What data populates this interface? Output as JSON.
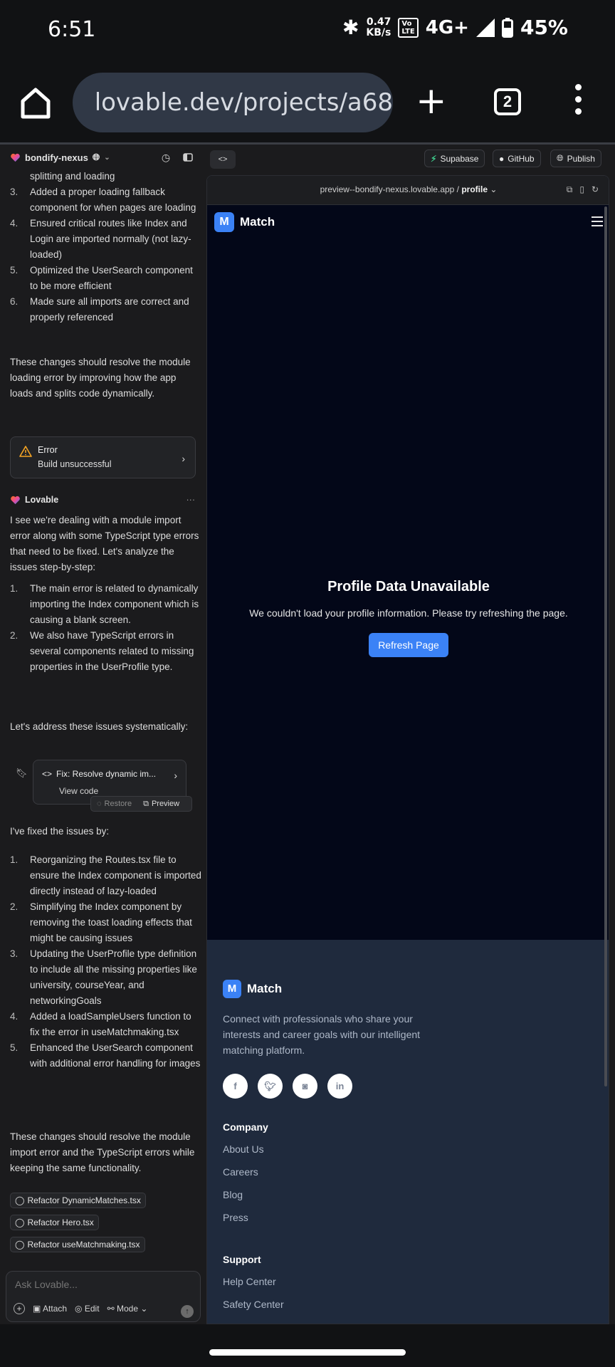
{
  "status_bar": {
    "time": "6:51",
    "net_speed_value": "0.47",
    "net_speed_unit": "KB/s",
    "volte_top": "Vo",
    "volte_bottom": "LTE",
    "network": "4G+",
    "battery": "45%"
  },
  "browser": {
    "url": "lovable.dev/projects/a68",
    "tab_count": "2"
  },
  "app_header": {
    "project_name": "bondify-nexus",
    "supabase_label": "Supabase",
    "github_label": "GitHub",
    "publish_label": "Publish",
    "code_toggle": "<>"
  },
  "chat": {
    "list1": [
      {
        "num": "",
        "text": "splitting and loading"
      },
      {
        "num": "3.",
        "text": "Added a proper loading fallback component for when pages are loading"
      },
      {
        "num": "4.",
        "text": "Ensured critical routes like Index and Login are imported normally (not lazy-loaded)"
      },
      {
        "num": "5.",
        "text": "Optimized the UserSearch component to be more efficient"
      },
      {
        "num": "6.",
        "text": "Made sure all imports are correct and properly referenced"
      }
    ],
    "para1": "These changes should resolve the module loading error by improving how the app loads and splits code dynamically.",
    "error_title": "Error",
    "error_sub": "Build unsuccessful",
    "lovable_name": "Lovable",
    "more_dots": "···",
    "para2": "I see we're dealing with a module import error along with some TypeScript type errors that need to be fixed. Let's analyze the issues step-by-step:",
    "list2": [
      {
        "num": "1.",
        "text": "The main error is related to dynamically importing the Index component which is causing a blank screen."
      },
      {
        "num": "2.",
        "text": "We also have TypeScript errors in several components related to missing properties in the UserProfile type."
      }
    ],
    "para3": "Let's address these issues systematically:",
    "card_title": "Fix: Resolve dynamic im...",
    "card_view": "View code",
    "restore_label": "Restore",
    "preview_label": "Preview",
    "para4": "I've fixed the issues by:",
    "list3": [
      {
        "num": "1.",
        "text": "Reorganizing the Routes.tsx file to ensure the Index component is imported directly instead of lazy-loaded"
      },
      {
        "num": "2.",
        "text": "Simplifying the Index component by removing the toast loading effects that might be causing issues"
      },
      {
        "num": "3.",
        "text": "Updating the UserProfile type definition to include all the missing properties like university, courseYear, and networkingGoals"
      },
      {
        "num": "4.",
        "text": "Added a loadSampleUsers function to fix the error in useMatchmaking.tsx"
      },
      {
        "num": "5.",
        "text": "Enhanced the UserSearch component with additional error handling for images"
      }
    ],
    "para5": "These changes should resolve the module import error and the TypeScript errors while keeping the same functionality.",
    "refactor_chips": [
      "Refactor DynamicMatches.tsx",
      "Refactor Hero.tsx",
      "Refactor useMatchmaking.tsx"
    ],
    "input_placeholder": "Ask Lovable...",
    "attach_label": "Attach",
    "edit_label": "Edit",
    "mode_label": "Mode"
  },
  "preview": {
    "url_prefix": "preview--bondify-nexus.lovable.app / ",
    "url_page": "profile",
    "logo_letter": "M",
    "logo_text": "Match",
    "unavailable_title": "Profile Data Unavailable",
    "unavailable_sub": "We couldn't load your profile information. Please try refreshing the page.",
    "refresh_label": "Refresh Page",
    "footer": {
      "logo_letter": "M",
      "logo_text": "Match",
      "description": "Connect with professionals who share your interests and career goals with our intelligent matching platform.",
      "social": [
        "facebook-icon",
        "twitter-icon",
        "instagram-icon",
        "linkedin-icon"
      ],
      "company_heading": "Company",
      "company_links": [
        "About Us",
        "Careers",
        "Blog",
        "Press"
      ],
      "support_heading": "Support",
      "support_links": [
        "Help Center",
        "Safety Center"
      ]
    }
  },
  "colors": {
    "accent": "#3b82f6",
    "site_bg": "#030718",
    "footer_bg": "#1f2a3d",
    "app_bg": "#1b1b1d"
  }
}
